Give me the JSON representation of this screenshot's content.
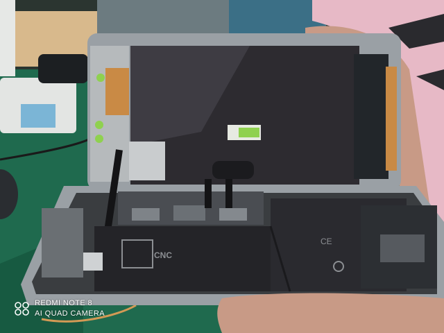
{
  "photo": {
    "subject": "Disassembled smartphone on a repair mat",
    "colors": {
      "mat": "#1f6a4e",
      "frame": "#9aa0a5",
      "screen_back": "#2d2b30",
      "battery": "#242428",
      "board": "#3a3d40",
      "shield": "#c9ccce",
      "skin": "#c89a86",
      "sleeve": "#e7b9c6",
      "connector_green": "#8fd14f"
    }
  },
  "battery_label": {
    "brand": "CNC"
  },
  "camera_watermark": {
    "line1": "REDMI NOTE 8",
    "line2": "AI QUAD CAMERA",
    "icon": "four-dot-camera-logo"
  }
}
